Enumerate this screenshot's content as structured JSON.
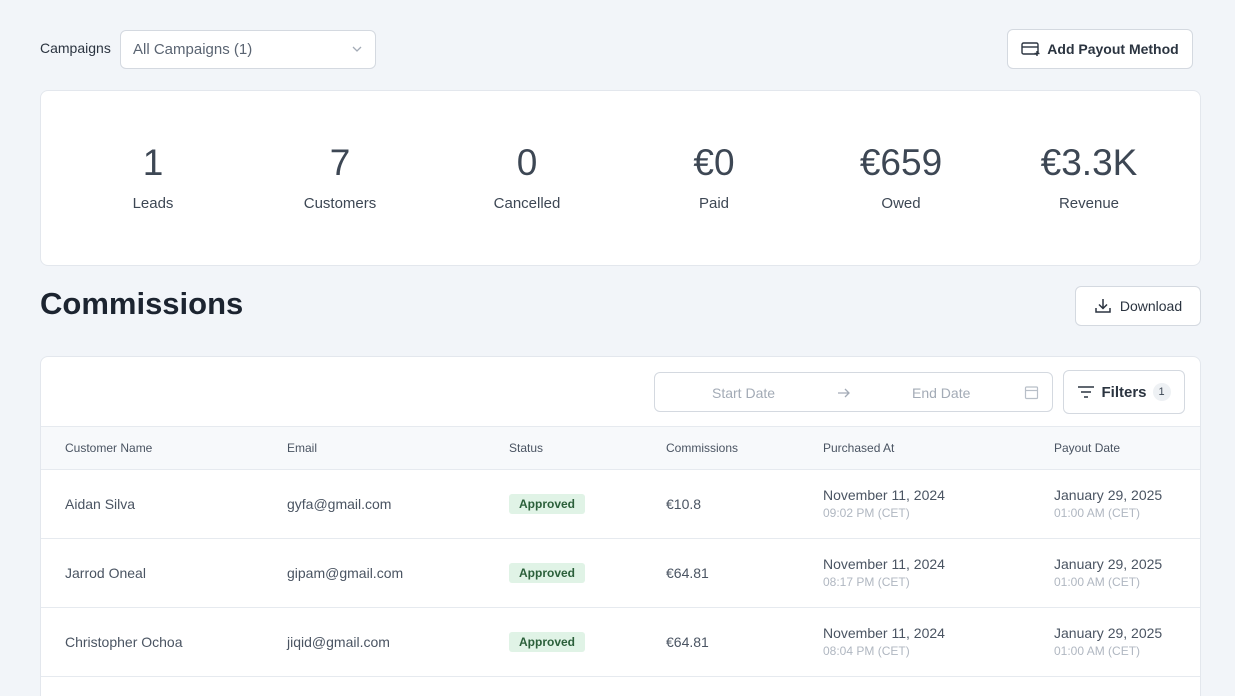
{
  "toolbar": {
    "campaigns_label": "Campaigns",
    "campaign_selected": "All Campaigns (1)",
    "add_payout_label": "Add Payout Method"
  },
  "stats": [
    {
      "value": "1",
      "label": "Leads"
    },
    {
      "value": "7",
      "label": "Customers"
    },
    {
      "value": "0",
      "label": "Cancelled"
    },
    {
      "value": "€0",
      "label": "Paid"
    },
    {
      "value": "€659",
      "label": "Owed"
    },
    {
      "value": "€3.3K",
      "label": "Revenue"
    }
  ],
  "commissions": {
    "title": "Commissions",
    "download_label": "Download",
    "start_date_placeholder": "Start Date",
    "end_date_placeholder": "End Date",
    "filters_label": "Filters",
    "filters_count": "1",
    "columns": [
      "Customer Name",
      "Email",
      "Status",
      "Commissions",
      "Purchased At",
      "Payout Date"
    ],
    "rows": [
      {
        "name": "Aidan Silva",
        "email": "gyfa@gmail.com",
        "status": "Approved",
        "commission": "€10.8",
        "purchased_date": "November 11, 2024",
        "purchased_time": "09:02 PM (CET)",
        "payout_date": "January 29, 2025",
        "payout_time": "01:00 AM (CET)"
      },
      {
        "name": "Jarrod Oneal",
        "email": "gipam@gmail.com",
        "status": "Approved",
        "commission": "€64.81",
        "purchased_date": "November 11, 2024",
        "purchased_time": "08:17 PM (CET)",
        "payout_date": "January 29, 2025",
        "payout_time": "01:00 AM (CET)"
      },
      {
        "name": "Christopher Ochoa",
        "email": "jiqid@gmail.com",
        "status": "Approved",
        "commission": "€64.81",
        "purchased_date": "November 11, 2024",
        "purchased_time": "08:04 PM (CET)",
        "payout_date": "January 29, 2025",
        "payout_time": "01:00 AM (CET)"
      }
    ]
  }
}
